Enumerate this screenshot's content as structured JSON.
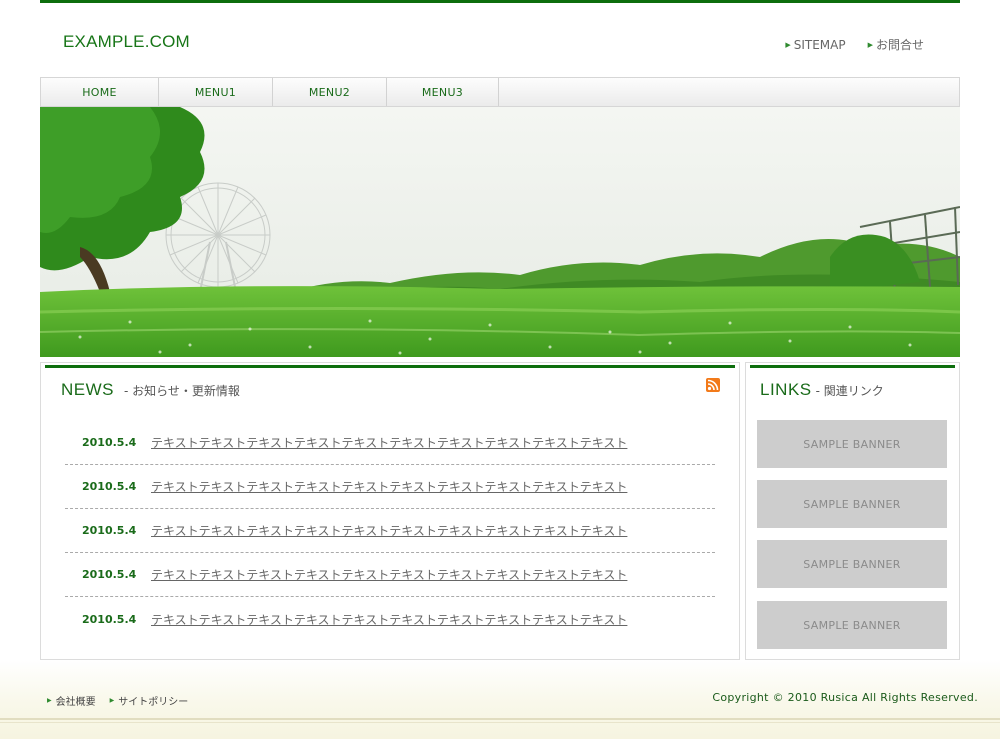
{
  "site": {
    "logo": "EXAMPLE.COM"
  },
  "utility": [
    {
      "label": "SITEMAP"
    },
    {
      "label": "お問合せ"
    }
  ],
  "nav": [
    {
      "label": "HOME"
    },
    {
      "label": "MENU1"
    },
    {
      "label": "MENU2"
    },
    {
      "label": "MENU3"
    }
  ],
  "news": {
    "title": "NEWS",
    "subtitle": "- お知らせ・更新情報",
    "rss_icon": "rss-icon",
    "items": [
      {
        "date": "2010.5.4",
        "text": "テキストテキストテキストテキストテキストテキストテキストテキストテキストテキスト"
      },
      {
        "date": "2010.5.4",
        "text": "テキストテキストテキストテキストテキストテキストテキストテキストテキストテキスト"
      },
      {
        "date": "2010.5.4",
        "text": "テキストテキストテキストテキストテキストテキストテキストテキストテキストテキスト"
      },
      {
        "date": "2010.5.4",
        "text": "テキストテキストテキストテキストテキストテキストテキストテキストテキストテキスト"
      },
      {
        "date": "2010.5.4",
        "text": "テキストテキストテキストテキストテキストテキストテキストテキストテキストテキスト"
      }
    ]
  },
  "links": {
    "title": "LINKS",
    "subtitle": "- 関連リンク",
    "banners": [
      {
        "label": "SAMPLE BANNER"
      },
      {
        "label": "SAMPLE BANNER"
      },
      {
        "label": "SAMPLE BANNER"
      },
      {
        "label": "SAMPLE BANNER"
      }
    ]
  },
  "footer": {
    "links": [
      {
        "label": "会社概要"
      },
      {
        "label": "サイトポリシー"
      }
    ],
    "copyright": "Copyright © 2010 Rusica All Rights Reserved."
  },
  "colors": {
    "brand_green": "#0d6e0d",
    "link_green": "#1a6b1a",
    "banner_gray": "#cdcdcd",
    "rss_orange": "#f27a1a"
  }
}
